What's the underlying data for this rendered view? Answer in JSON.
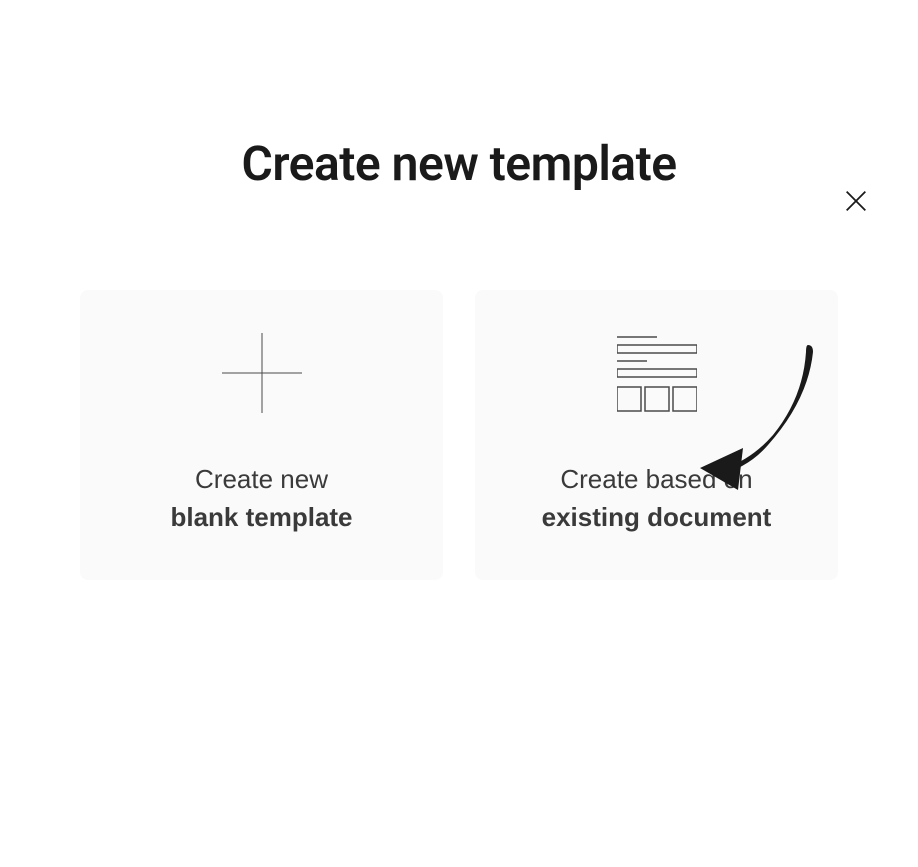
{
  "modal": {
    "title": "Create new template",
    "close_icon": "close-icon"
  },
  "options": {
    "blank": {
      "line1": "Create new",
      "line2": "blank template",
      "icon": "plus-icon"
    },
    "existing": {
      "line1": "Create based on",
      "line2": "existing document",
      "icon": "document-layout-icon"
    }
  }
}
